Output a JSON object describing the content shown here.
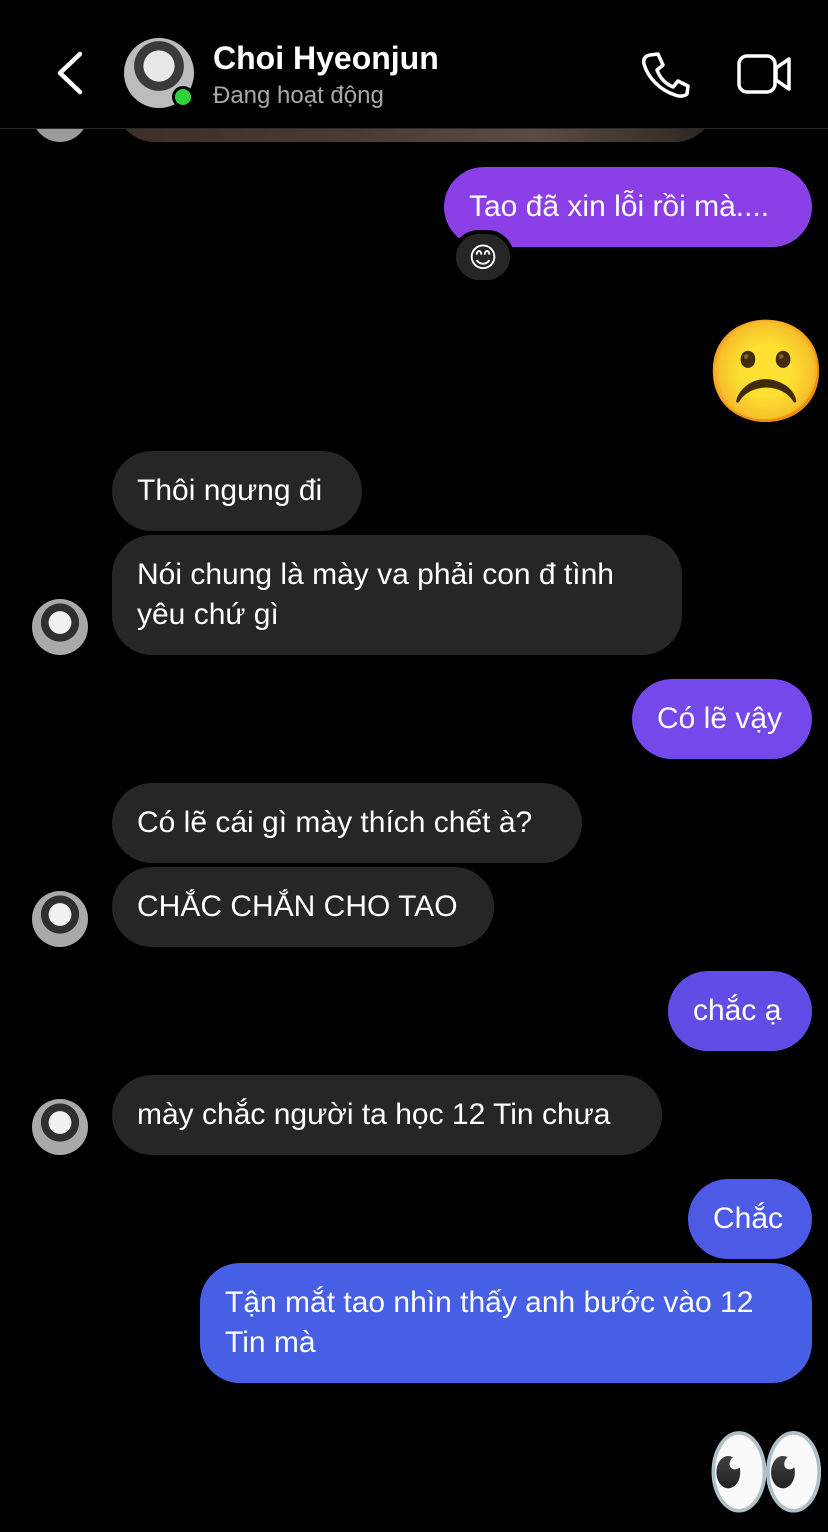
{
  "header": {
    "name": "Choi Hyeonjun",
    "status": "Đang hoạt động",
    "online_color": "#31d13d",
    "icons": [
      "back-chevron-icon",
      "phone-icon",
      "video-camera-icon"
    ]
  },
  "messages": [
    {
      "side": "out",
      "text": "Tao đã xin lỗi rồi mà....",
      "color": "#8b3fe6",
      "reaction": "😊"
    },
    {
      "side": "out",
      "emoji": "☹️"
    },
    {
      "side": "in",
      "text": "Thôi ngưng đi"
    },
    {
      "side": "in",
      "text_line1": "Nói chung là mày va phải con đ tình",
      "text_line2": "yêu chứ gì"
    },
    {
      "side": "out",
      "text": "Có lẽ vậy",
      "color": "#7448ea"
    },
    {
      "side": "in",
      "text": "Có lẽ cái gì mày thích chết à?"
    },
    {
      "side": "in",
      "text": "CHẮC CHẮN CHO TAO"
    },
    {
      "side": "out",
      "text": "chắc ạ",
      "color": "#5f4de6"
    },
    {
      "side": "in",
      "text": "mày chắc người ta học 12 Tin chưa"
    },
    {
      "side": "out",
      "text": "Chắc",
      "color": "#4d5ae6"
    },
    {
      "side": "out",
      "text_line1": "Tận mắt tao nhìn thấy anh bước vào 12",
      "text_line2": "Tin mà",
      "color": "#465fe5"
    },
    {
      "side": "out",
      "emoji": "👀"
    }
  ]
}
